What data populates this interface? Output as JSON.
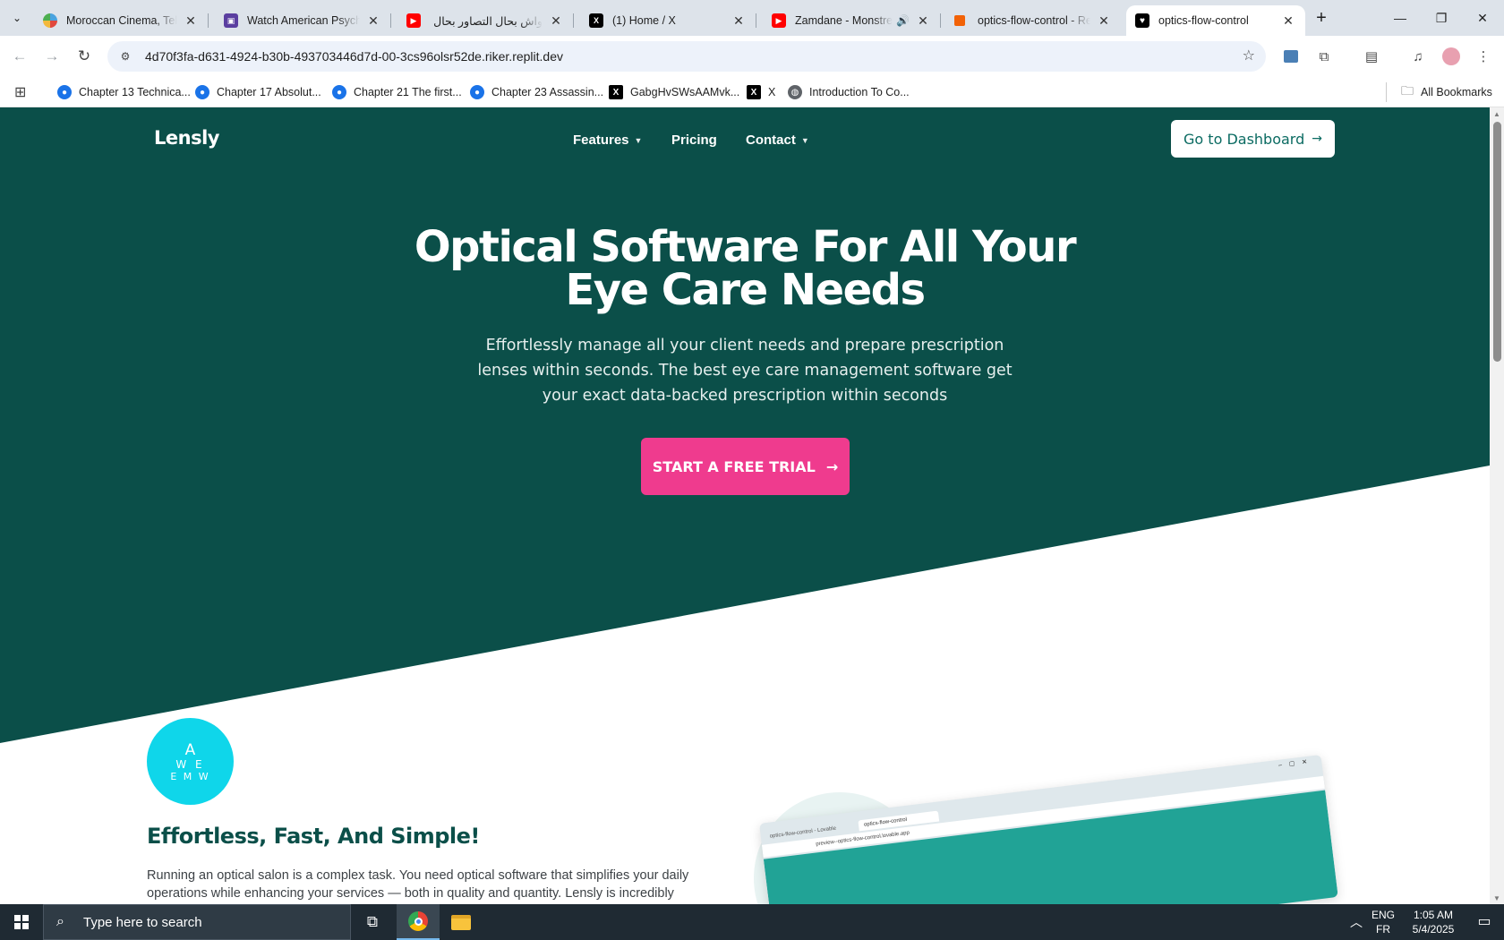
{
  "browser": {
    "tabs": [
      {
        "title": "Moroccan Cinema, Televi",
        "favicon": "colorful-circle-icon",
        "color": "#4aa3df"
      },
      {
        "title": "Watch American Psycho",
        "favicon": "film-icon",
        "color": "#5b3fa0"
      },
      {
        "title": "واش بحال التصاور بحال الـ",
        "favicon": "youtube-icon",
        "color": "#ff0000"
      },
      {
        "title": "(1) Home / X",
        "favicon": "x-icon",
        "color": "#000000"
      },
      {
        "title": "Zamdane - Monstres",
        "favicon": "youtube-icon",
        "color": "#ff0000"
      },
      {
        "title": "optics-flow-control - Rep",
        "favicon": "replit-icon",
        "color": "#f26207"
      },
      {
        "title": "optics-flow-control",
        "favicon": "heart-icon",
        "color": "#000000"
      }
    ],
    "url": "4d70f3fa-d631-4924-b30b-493703446d7d-00-3cs96olsr52de.riker.replit.dev",
    "bookmarks": [
      {
        "label": "Chapter 13 Technica...",
        "icon": "course-icon",
        "color": "#1a73e8"
      },
      {
        "label": "Chapter 17 Absolut...",
        "icon": "course-icon",
        "color": "#1a73e8"
      },
      {
        "label": "Chapter 21 The first...",
        "icon": "course-icon",
        "color": "#1a73e8"
      },
      {
        "label": "Chapter 23 Assassin...",
        "icon": "course-icon",
        "color": "#1a73e8"
      },
      {
        "label": "GabgHvSWsAAMvk...",
        "icon": "x-icon",
        "color": "#000000"
      },
      {
        "label": "X",
        "icon": "x-icon",
        "color": "#000000"
      },
      {
        "label": "Introduction To Co...",
        "icon": "globe-icon",
        "color": "#5f6368"
      }
    ],
    "all_bookmarks": "All Bookmarks"
  },
  "page": {
    "logo": "Lensly",
    "nav": {
      "features": "Features",
      "pricing": "Pricing",
      "contact": "Contact"
    },
    "dashboard_button": "Go to Dashboard",
    "hero_title": "Optical Software For All Your Eye Care Needs",
    "hero_subtitle": "Effortlessly manage all your client needs and prepare prescription lenses within seconds. The best eye care management software get your exact data-backed prescription within seconds",
    "cta": "START A FREE TRIAL",
    "badge": {
      "line1": "A",
      "line2": "W E",
      "line3": "E M W"
    },
    "feature_title": "Effortless, Fast, And Simple!",
    "feature_body": "Running an optical salon is a complex task. You need optical software that simplifies your daily operations while enhancing your services — both in quality and quantity. Lensly is incredibly",
    "mockup": {
      "tab_title": "optics-flow-control",
      "tab_other": "optics-flow-control - Lovable",
      "url": "preview--optics-flow-control.lovable.app"
    },
    "colors": {
      "hero": "#0b4f49",
      "cta": "#ef3b8e",
      "accent": "#0fd6ea",
      "heading": "#0b4f49"
    }
  },
  "taskbar": {
    "search_placeholder": "Type here to search",
    "lang_top": "ENG",
    "lang_bottom": "FR",
    "time": "1:05 AM",
    "date": "5/4/2025"
  }
}
